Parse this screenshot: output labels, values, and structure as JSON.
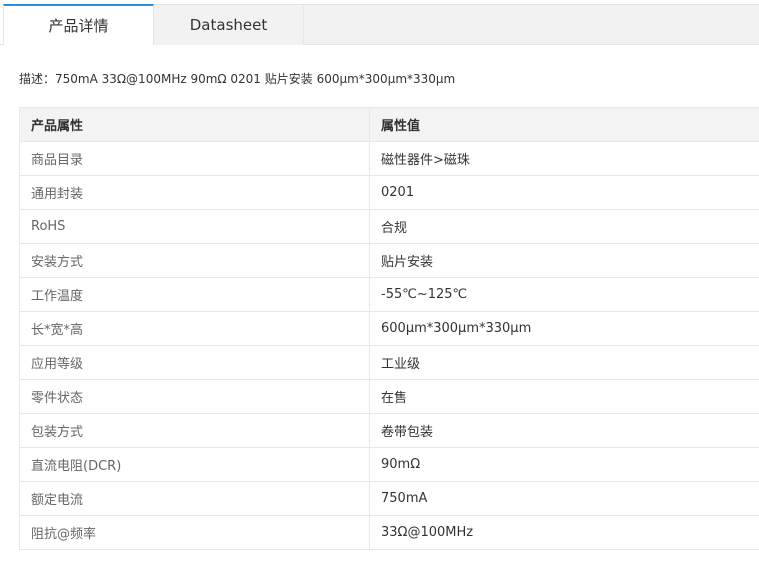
{
  "tabs": {
    "details_label": "产品详情",
    "datasheet_label": "Datasheet"
  },
  "description": "描述：750mA 33Ω@100MHz 90mΩ 0201 贴片安装 600μm*300μm*330μm",
  "table": {
    "headers": [
      "产品属性",
      "属性值"
    ],
    "rows": [
      [
        "商品目录",
        "磁性器件>磁珠"
      ],
      [
        "通用封装",
        "0201"
      ],
      [
        "RoHS",
        "合规"
      ],
      [
        "安装方式",
        "贴片安装"
      ],
      [
        "工作温度",
        "-55℃~125℃"
      ],
      [
        "长*宽*高",
        "600μm*300μm*330μm"
      ],
      [
        "应用等级",
        "工业级"
      ],
      [
        "零件状态",
        "在售"
      ],
      [
        "包装方式",
        "卷带包装"
      ],
      [
        "直流电阻(DCR)",
        "90mΩ"
      ],
      [
        "额定电流",
        "750mA"
      ],
      [
        "阻抗@频率",
        "33Ω@100MHz"
      ]
    ]
  },
  "colors": {
    "accent": "#2b8cd8",
    "header_bg": "#f3f3f3",
    "border": "#e8e8e8"
  }
}
